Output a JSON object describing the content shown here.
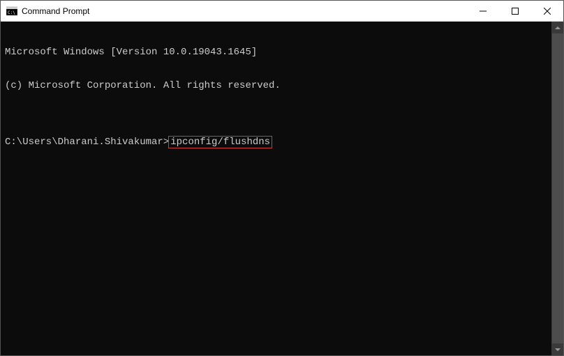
{
  "window": {
    "title": "Command Prompt"
  },
  "terminal": {
    "line1": "Microsoft Windows [Version 10.0.19043.1645]",
    "line2": "(c) Microsoft Corporation. All rights reserved.",
    "blank": "",
    "prompt": "C:\\Users\\Dharani.Shivakumar>",
    "command": "ipconfig/flushdns"
  }
}
